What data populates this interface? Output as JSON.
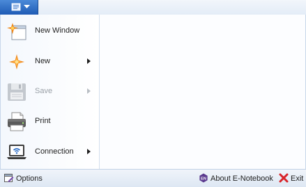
{
  "menu": {
    "items": [
      {
        "label": "New Window",
        "icon": "new-window-icon",
        "submenu": false,
        "enabled": true
      },
      {
        "label": "New",
        "icon": "new-star-icon",
        "submenu": true,
        "enabled": true
      },
      {
        "label": "Save",
        "icon": "save-disk-icon",
        "submenu": true,
        "enabled": false
      },
      {
        "label": "Print",
        "icon": "printer-icon",
        "submenu": false,
        "enabled": true
      },
      {
        "label": "Connection",
        "icon": "connection-laptop-icon",
        "submenu": true,
        "enabled": true
      }
    ]
  },
  "footer": {
    "options_label": "Options",
    "about_label": "About E-Notebook",
    "exit_label": "Exit"
  },
  "colors": {
    "accent": "#2f6fc7",
    "star_orange": "#f08a1c",
    "exit_red": "#d8242a",
    "about_purple": "#5b3a8f"
  }
}
